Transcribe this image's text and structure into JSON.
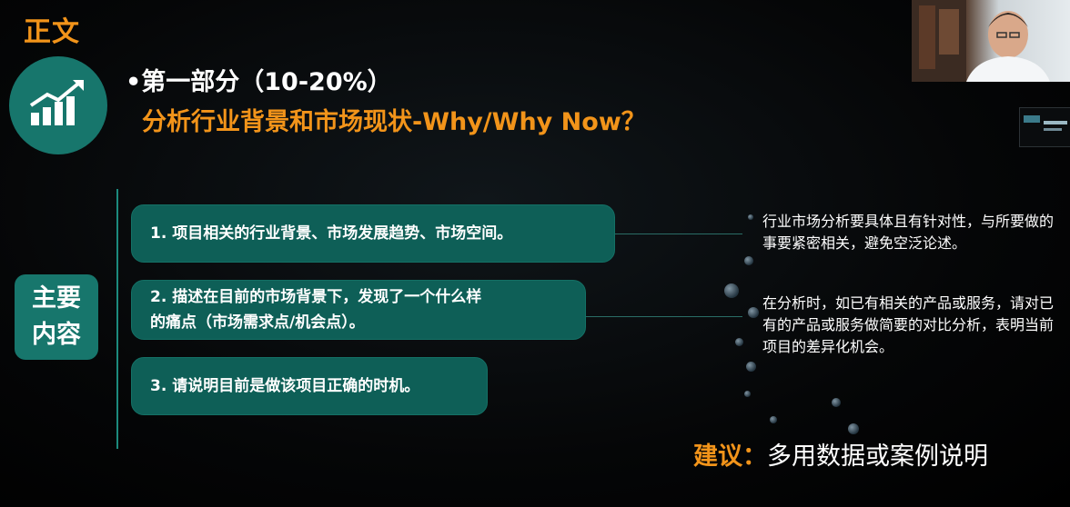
{
  "section_title": "正文",
  "part": {
    "line1": "•第一部分（10-20%）",
    "line2": "分析行业背景和市场现状-Why/Why Now？"
  },
  "main_content_label": {
    "line1": "主要",
    "line2": "内容"
  },
  "items": [
    {
      "text": "1. 项目相关的行业背景、市场发展趋势、市场空间。"
    },
    {
      "line1": "2. 描述在目前的市场背景下，发现了一个什么样",
      "line2": "的痛点（市场需求点/机会点）。"
    },
    {
      "text": "3. 请说明目前是做该项目正确的时机。"
    }
  ],
  "notes": [
    "行业市场分析要具体且有针对性，与所要做的事要紧密相关，避免空泛论述。",
    "在分析时，如已有相关的产品或服务，请对已有的产品或服务做简要的对比分析，表明当前项目的差异化机会。"
  ],
  "suggestion": {
    "label": "建议：",
    "text": "多用数据或案例说明"
  },
  "icons": {
    "badge": "trend-chart-icon"
  },
  "colors": {
    "accent": "#f2941a",
    "teal": "#17766c",
    "card": "#0e5f57",
    "background": "#000000"
  }
}
